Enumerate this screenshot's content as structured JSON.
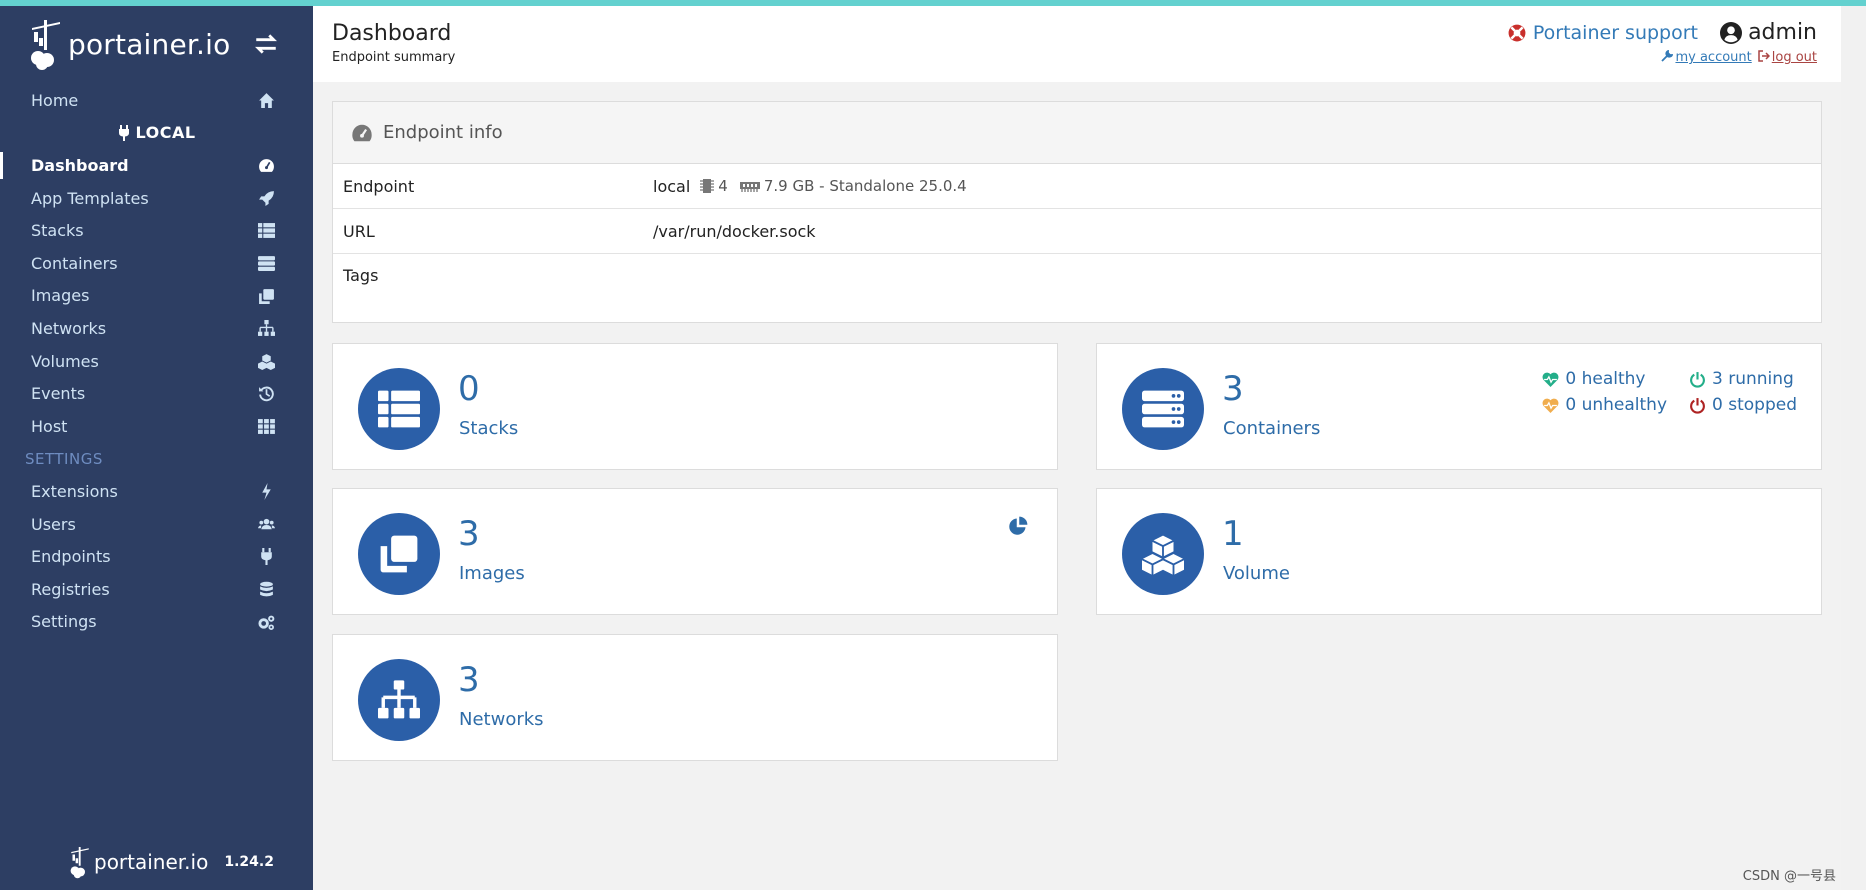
{
  "brand": {
    "logo_text": "portainer.io",
    "version": "1.24.2"
  },
  "sidebar": {
    "home": "Home",
    "endpoint_heading": "LOCAL",
    "items": [
      {
        "label": "Dashboard",
        "icon": "tachometer-icon"
      },
      {
        "label": "App Templates",
        "icon": "rocket-icon"
      },
      {
        "label": "Stacks",
        "icon": "th-list-icon"
      },
      {
        "label": "Containers",
        "icon": "server-icon"
      },
      {
        "label": "Images",
        "icon": "clone-icon"
      },
      {
        "label": "Networks",
        "icon": "sitemap-icon"
      },
      {
        "label": "Volumes",
        "icon": "cubes-icon"
      },
      {
        "label": "Events",
        "icon": "history-icon"
      },
      {
        "label": "Host",
        "icon": "th-icon"
      }
    ],
    "settings_heading": "SETTINGS",
    "settings_items": [
      {
        "label": "Extensions",
        "icon": "bolt-icon"
      },
      {
        "label": "Users",
        "icon": "users-icon"
      },
      {
        "label": "Endpoints",
        "icon": "plug-icon"
      },
      {
        "label": "Registries",
        "icon": "database-icon"
      },
      {
        "label": "Settings",
        "icon": "cogs-icon"
      }
    ]
  },
  "header": {
    "title": "Dashboard",
    "subtitle": "Endpoint summary",
    "support": "Portainer support",
    "user": "admin",
    "my_account": "my account",
    "log_out": "log out"
  },
  "endpoint_info": {
    "title": "Endpoint info",
    "rows": {
      "endpoint": {
        "key": "Endpoint",
        "name": "local",
        "cpu": "4",
        "memory": "7.9 GB - Standalone 25.0.4"
      },
      "url": {
        "key": "URL",
        "value": "/var/run/docker.sock"
      },
      "tags": {
        "key": "Tags",
        "value": ""
      }
    }
  },
  "tiles": {
    "stacks": {
      "count": "0",
      "label": "Stacks"
    },
    "containers": {
      "count": "3",
      "label": "Containers",
      "healthy": "0 healthy",
      "running": "3 running",
      "unhealthy": "0 unhealthy",
      "stopped": "0 stopped"
    },
    "images": {
      "count": "3",
      "label": "Images"
    },
    "volumes": {
      "count": "1",
      "label": "Volume"
    },
    "networks": {
      "count": "3",
      "label": "Networks"
    }
  },
  "colors": {
    "sidebar_bg": "#2d3e63",
    "accent": "#2b5fa8",
    "link": "#2e6ca8",
    "healthy": "#23ae89",
    "unhealthy": "#f0ad4e",
    "stopped": "#ae2323"
  },
  "watermark": "CSDN @一号县"
}
